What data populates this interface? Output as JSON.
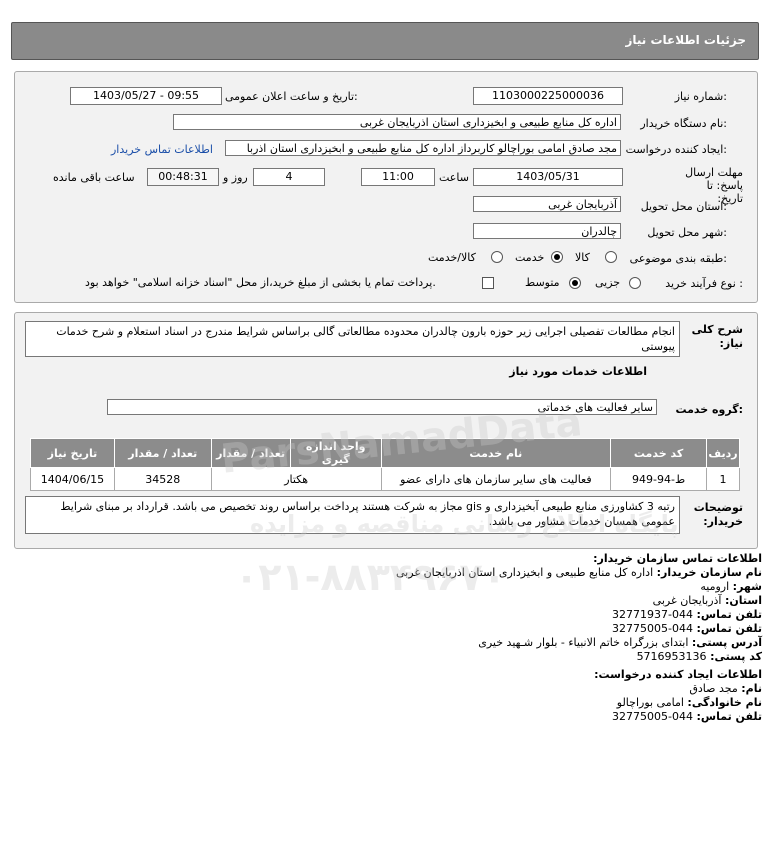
{
  "header": {
    "title": "جزئیات اطلاعات نیاز"
  },
  "need": {
    "need_number_label": "شماره نیاز:",
    "need_number": "1103000225000036",
    "announce_label": "تاریخ و ساعت اعلان عمومی:",
    "announce_value": "1403/05/27 - 09:55",
    "buyer_org_label": "نام دستگاه خریدار:",
    "buyer_org": "اداره کل منابع طبیعی و ابخیزداری استان اذربایجان غربی",
    "creator_label": "ایجاد کننده درخواست:",
    "creator": "مجد صادق امامی بوراچالو کاربرداز اداره کل منابع طبیعی و ابخیزداری استان اذربا",
    "contact_link": "اطلاعات تماس خریدار",
    "deadline_label": "مهلت ارسال پاسخ: تا تاریخ:",
    "deadline_date": "1403/05/31",
    "time_label": "ساعت",
    "deadline_time": "11:00",
    "days_value": "4",
    "days_label": "روز و",
    "remaining_time": "00:48:31",
    "remaining_label": "ساعت باقی مانده",
    "province_label": "استان محل تحویل:",
    "province": "آذربایجان غربی",
    "city_label": "شهر محل تحویل:",
    "city": "چالدران",
    "category_label": "طبقه بندی موضوعی:",
    "category_options": [
      "کالا",
      "خدمت",
      "کالا/خدمت"
    ],
    "category_selected": "خدمت",
    "process_label": "نوع فرآیند خرید :",
    "process_options": [
      "جزیی",
      "متوسط"
    ],
    "process_selected": "متوسط",
    "treasury_note": "پرداخت تمام یا بخشی از مبلغ خرید،از محل \"اسناد خزانه اسلامی\" خواهد بود."
  },
  "details": {
    "summary_label": "شرح کلی نیاز:",
    "summary": "انجام مطالعات تفصیلی اجرایی زیر حوزه بارون چالدران محدوده مطالعاتی گالی براساس شرایط مندرج در اسناد استعلام و شرح خدمات پیوستی",
    "services_title": "اطلاعات خدمات مورد نیاز",
    "service_group_label": "گروه خدمت:",
    "service_group": "سایر فعالیت های خدماتی",
    "table": {
      "headers": [
        "ردیف",
        "کد خدمت",
        "نام خدمت",
        "واحد اندازه گیری",
        "تعداد / مقدار",
        "تاریخ نیاز"
      ],
      "rows": [
        [
          "1",
          "ط-94-949",
          "فعالیت های سایر سازمان های دارای عضو",
          "هکتار",
          "34528",
          "1404/06/15"
        ]
      ]
    },
    "buyer_notes_label": "توضیحات خریدار:",
    "buyer_notes": "رتبه 3 کشاورزی منابع طبیعی آبخیزداری و gis مجاز به شرکت هستند پرداخت براساس روند تخصیص می باشد. قرارداد بر مبنای شرایط عمومی همسان خدمات مشاور می باشد."
  },
  "contact": {
    "title": "اطلاعات تماس سازمان خریدار:",
    "org_label": "نام سازمان خریدار:",
    "org": "اداره کل منابع طبیعی و ابخیزداری استان اذربایجان غربی",
    "city_label": "شهر:",
    "city": "ارومیه",
    "province_label": "استان:",
    "province": "آذربایجان غربی",
    "phone_label": "تلفن تماس:",
    "phone": "044-32771937",
    "fax_label": "تلفن تماس:",
    "fax": "044-32775005",
    "address_label": "آدرس پستی:",
    "address": "ابتدای بزرگراه خاتم الانبیاء - بلوار شـهید خیری",
    "postal_label": "کد پستی:",
    "postal": "5716953136",
    "creator_title": "اطلاعات ایجاد کننده درخواست:",
    "name_label": "نام:",
    "name": "مجد صادق",
    "family_label": "نام خانوادگی:",
    "family": "امامی بوراچالو",
    "creator_phone_label": "تلفن تماس:",
    "creator_phone": "044-32775005"
  },
  "watermark": {
    "brand": "ParsNamadData",
    "tagline": "پایگاه اطلاع رسانی مناقصه و مزایده",
    "phone": "۰۲۱-۸۸۳۴۹۶۷۰"
  }
}
